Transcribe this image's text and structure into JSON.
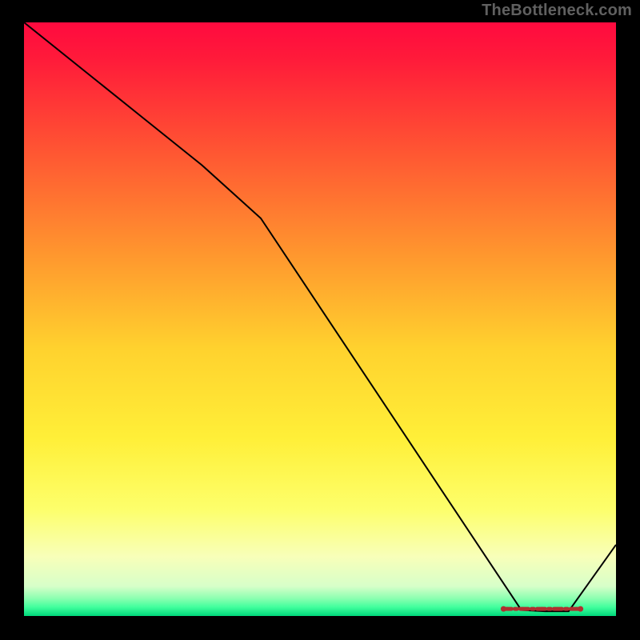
{
  "attribution": "TheBottleneck.com",
  "chart_data": {
    "type": "line",
    "title": "",
    "xlabel": "",
    "ylabel": "",
    "xlim": [
      0,
      100
    ],
    "ylim": [
      0,
      100
    ],
    "grid": false,
    "series": [
      {
        "name": "curve",
        "x": [
          0,
          10,
          20,
          30,
          40,
          50,
          60,
          70,
          80,
          84,
          88,
          92,
          100
        ],
        "values": [
          100,
          92,
          84,
          76,
          67,
          52,
          37,
          22,
          7,
          1,
          0.8,
          0.8,
          12
        ],
        "color": "#000000",
        "width": 2
      }
    ],
    "marker_band": {
      "name": "optimum-range",
      "x_start": 81,
      "x_end": 94,
      "y": 1.2,
      "color": "#b03030",
      "style": "dashed-dot-fill"
    },
    "background_gradient": {
      "stops": [
        {
          "pos": 0.0,
          "color": "#ff0a3f"
        },
        {
          "pos": 0.06,
          "color": "#ff1a3a"
        },
        {
          "pos": 0.2,
          "color": "#ff4f33"
        },
        {
          "pos": 0.4,
          "color": "#ff9a2e"
        },
        {
          "pos": 0.55,
          "color": "#ffd22e"
        },
        {
          "pos": 0.7,
          "color": "#ffef38"
        },
        {
          "pos": 0.82,
          "color": "#fdff6b"
        },
        {
          "pos": 0.9,
          "color": "#f8ffb9"
        },
        {
          "pos": 0.95,
          "color": "#d7ffc9"
        },
        {
          "pos": 0.97,
          "color": "#8dffb1"
        },
        {
          "pos": 0.985,
          "color": "#41ff9d"
        },
        {
          "pos": 1.0,
          "color": "#00d77a"
        }
      ]
    }
  }
}
